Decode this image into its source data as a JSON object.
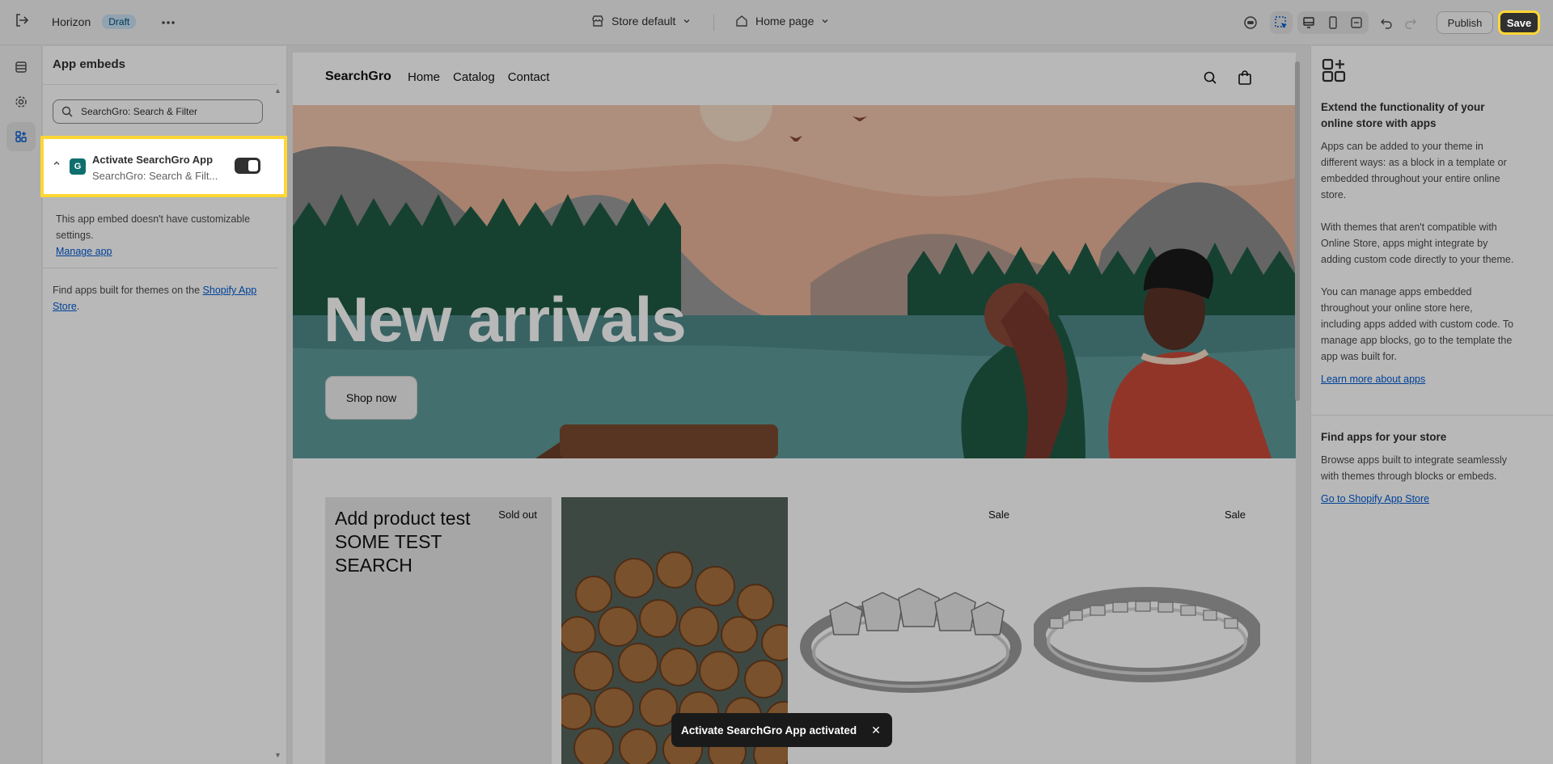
{
  "topbar": {
    "theme_name": "Horizon",
    "draft_badge": "Draft",
    "store_selector": "Store default",
    "page_selector": "Home page",
    "publish_label": "Publish",
    "save_label": "Save"
  },
  "left_panel": {
    "title": "App embeds",
    "search_value": "SearchGro: Search & Filter",
    "embed": {
      "title": "Activate SearchGro App",
      "subtitle": "SearchGro: Search & Filt...",
      "enabled": true,
      "no_settings_text": "This app embed doesn't have customizable settings.",
      "manage_link": "Manage app"
    },
    "find_apps_text": "Find apps built for themes on the ",
    "find_apps_link": "Shopify App Store",
    "find_apps_end": "."
  },
  "preview": {
    "brand": "SearchGro",
    "nav": [
      "Home",
      "Catalog",
      "Contact"
    ],
    "hero_title": "New arrivals",
    "hero_button": "Shop now",
    "products": [
      {
        "title": "Add product test SOME TEST SEARCH",
        "badge": "Sold out"
      },
      {
        "title": "",
        "badge": ""
      },
      {
        "title": "",
        "badge": "Sale"
      },
      {
        "title": "",
        "badge": "Sale"
      }
    ]
  },
  "toast": {
    "message": "Activate SearchGro App activated"
  },
  "right_panel": {
    "heading1": "Extend the functionality of your online store with apps",
    "p1": "Apps can be added to your theme in different ways: as a block in a template or embedded throughout your entire online store.",
    "p2": "With themes that aren't compatible with Online Store, apps might integrate by adding custom code directly to your theme.",
    "p3": "You can manage apps embedded throughout your online store here, including apps added with custom code. To manage app blocks, go to the template the app was built for.",
    "link1": "Learn more about apps",
    "heading2": "Find apps for your store",
    "p4": "Browse apps built to integrate seamlessly with themes through blocks or embeds.",
    "link2": "Go to Shopify App Store"
  },
  "colors": {
    "highlight": "#ffd633",
    "link": "#005bd3",
    "dark": "#303030"
  }
}
